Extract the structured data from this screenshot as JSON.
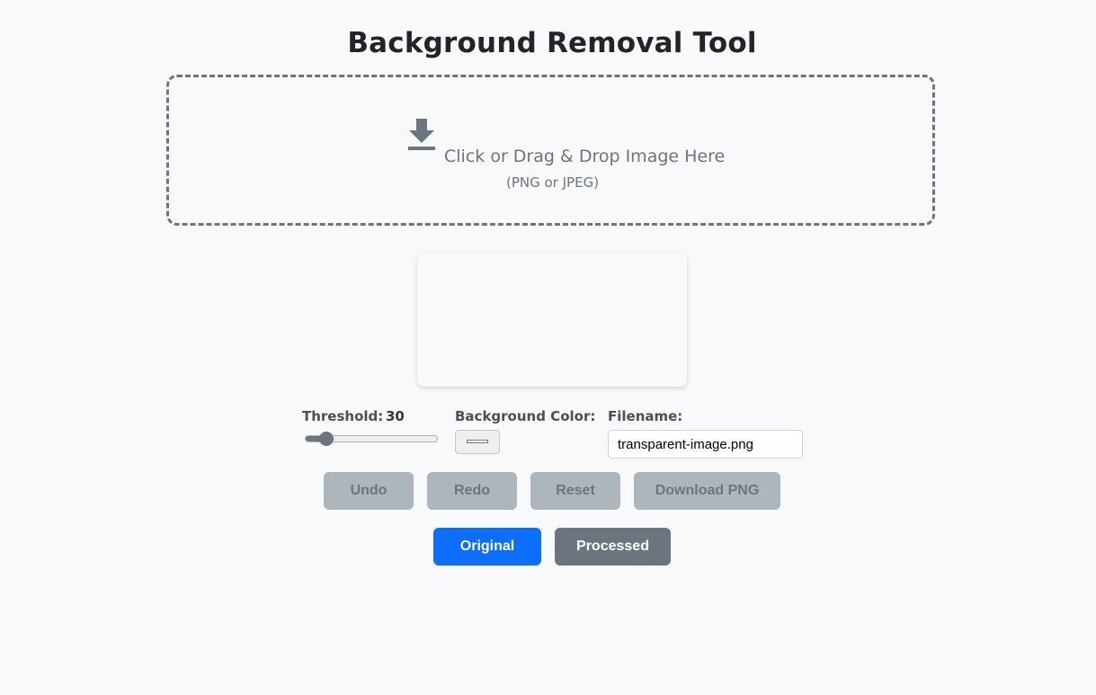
{
  "page": {
    "title": "Background Removal Tool"
  },
  "upload": {
    "main_text": "Click or Drag & Drop Image Here",
    "sub_text": "(PNG or JPEG)",
    "icon": "download-arrow-icon"
  },
  "controls": {
    "threshold": {
      "label": "Threshold:",
      "value": "30",
      "min": 0,
      "max": 255,
      "level": 30
    },
    "background_color": {
      "label": "Background Color:",
      "value": "#ffffff"
    },
    "filename": {
      "label": "Filename:",
      "value": "transparent-image.png"
    }
  },
  "actions": {
    "undo_label": "Undo",
    "redo_label": "Redo",
    "reset_label": "Reset",
    "download_label": "Download PNG"
  },
  "view_toggle": {
    "original_label": "Original",
    "processed_label": "Processed"
  },
  "colors": {
    "accent": "#0d6efd",
    "secondary": "#6c757d",
    "disabled": "#adb5bd",
    "background": "#f8f9fa"
  }
}
